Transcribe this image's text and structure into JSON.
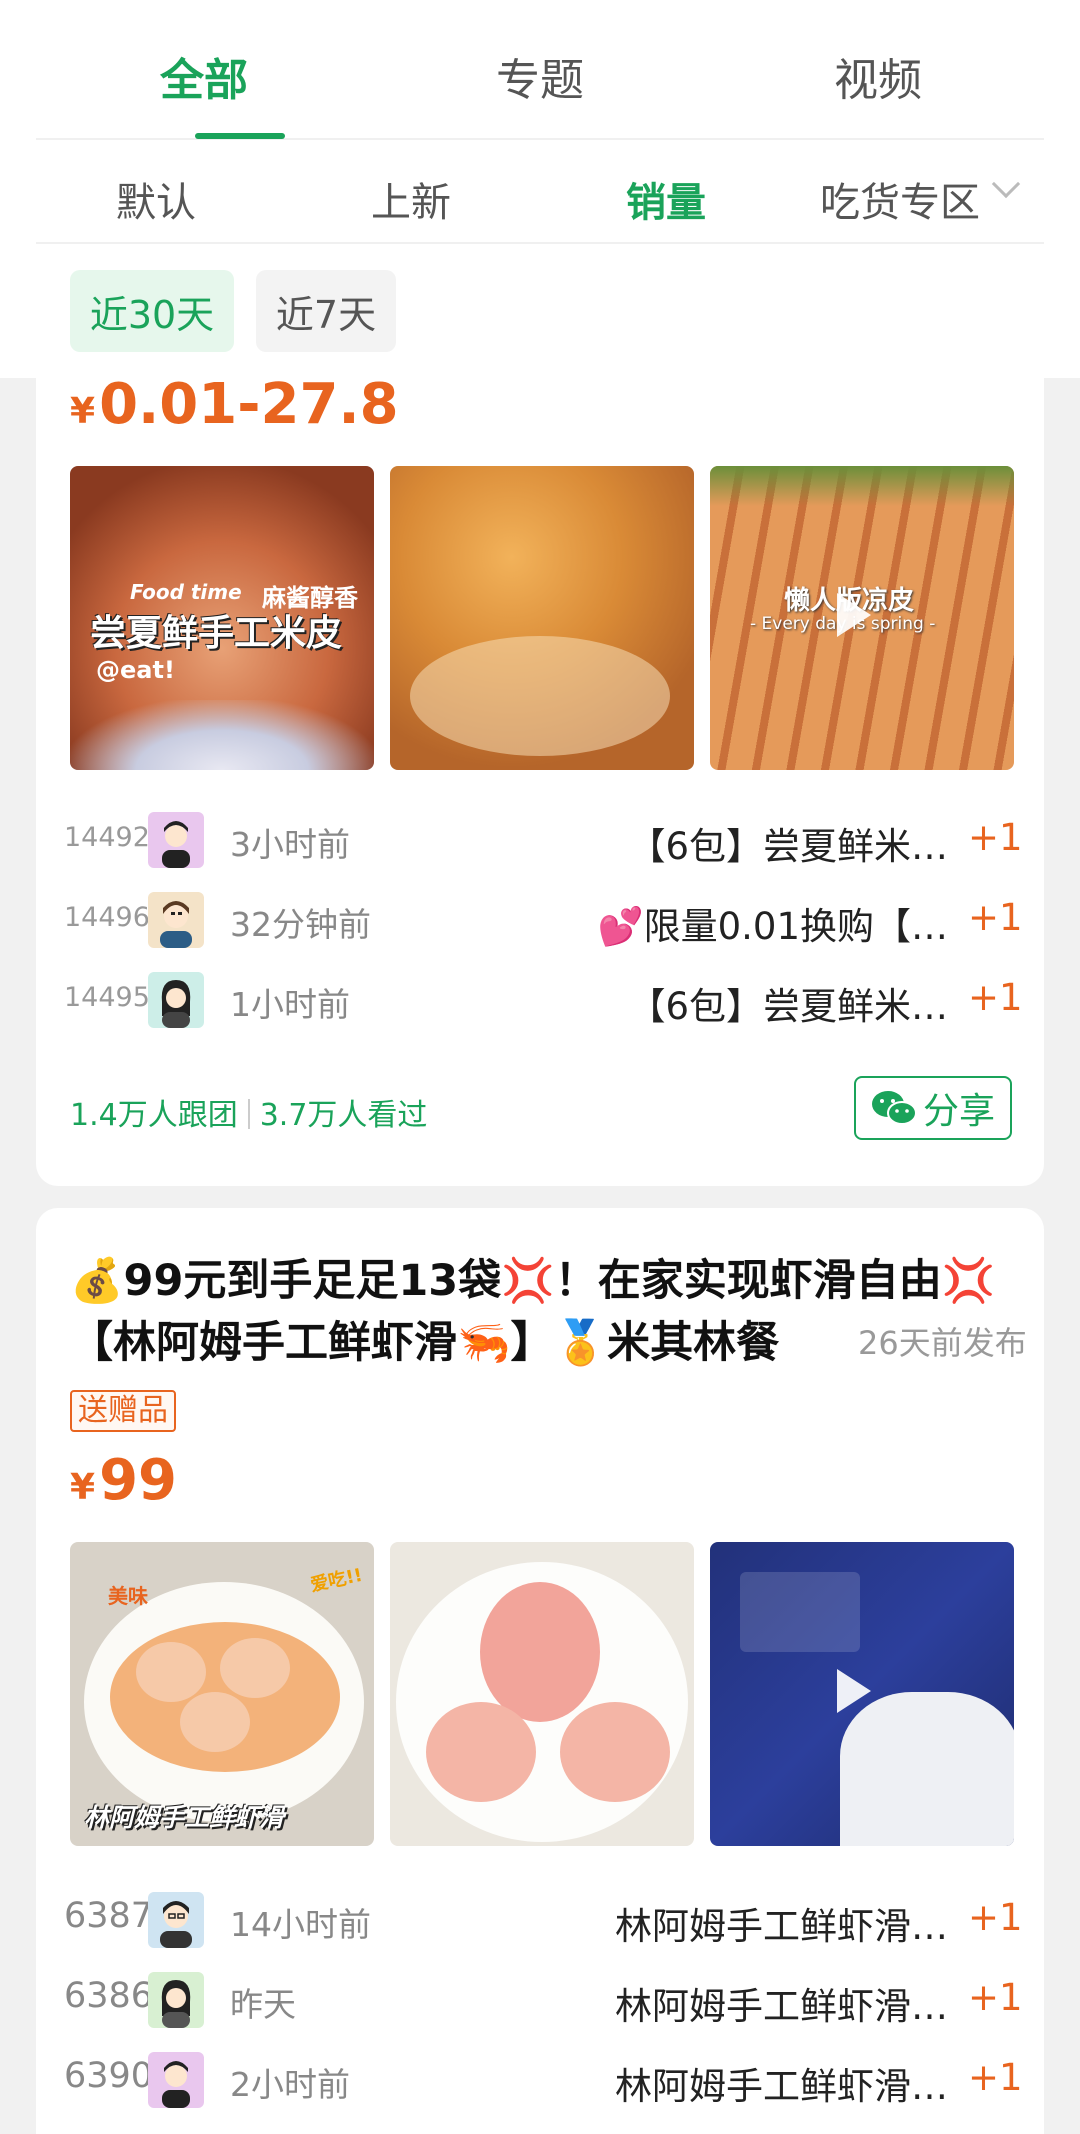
{
  "tabs": {
    "all": "全部",
    "topic": "专题",
    "video": "视频"
  },
  "sort": {
    "default": "默认",
    "new": "上新",
    "sales": "销量",
    "zone": "吃货专区"
  },
  "range": {
    "d30": "近30天",
    "d7": "近7天"
  },
  "card1": {
    "currency": "¥",
    "price": "0.01-27.8",
    "photo1_caption": "尝夏鲜手工米皮",
    "photo1_tag": "麻酱醇香",
    "photo1_sub": "Food time",
    "photo1_handle": "@eat!",
    "photo3_caption": "懒人版凉皮",
    "photo3_sub": "- Every day is spring -",
    "rows": [
      {
        "id": "14492",
        "time": "3小时前",
        "title": "【6包】尝夏鲜米…",
        "plus": "+1"
      },
      {
        "id": "14496",
        "time": "32分钟前",
        "title": "💕限量0.01换购【…",
        "plus": "+1"
      },
      {
        "id": "14495",
        "time": "1小时前",
        "title": "【6包】尝夏鲜米…",
        "plus": "+1"
      }
    ],
    "stats_follow": "1.4万人跟团",
    "stats_view": "3.7万人看过",
    "share": "分享"
  },
  "card2": {
    "title": "💰99元到手足足13袋💢！在家实现虾滑自由💢【林阿姆手工鲜虾滑🦐】🏅米其林餐",
    "ago": "26天前发布",
    "gift": "送赠品",
    "currency": "¥",
    "price": "99",
    "photo1_caption": "林阿姆手工鲜虾滑",
    "photo1_tag1": "美味",
    "photo1_tag2": "爱吃!!",
    "rows": [
      {
        "id": "6387",
        "time": "14小时前",
        "title": "林阿姆手工鲜虾滑…",
        "plus": "+1"
      },
      {
        "id": "6386",
        "time": "昨天",
        "title": "林阿姆手工鲜虾滑…",
        "plus": "+1"
      },
      {
        "id": "6390",
        "time": "2小时前",
        "title": "林阿姆手工鲜虾滑…",
        "plus": "+1"
      }
    ]
  },
  "colors": {
    "brand_green": "#1aa35a",
    "price_orange": "#e8641f"
  }
}
